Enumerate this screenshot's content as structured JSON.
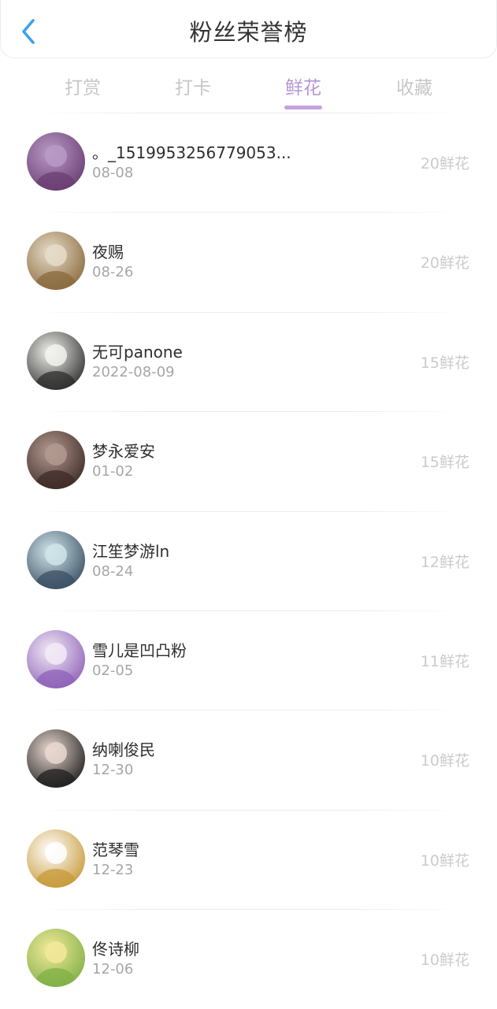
{
  "header": {
    "title": "粉丝荣誉榜",
    "back_icon": "chevron-left-icon",
    "accent_color": "#3aa3e8"
  },
  "tabs": [
    {
      "label": "打赏"
    },
    {
      "label": "打卡"
    },
    {
      "label": "鲜花",
      "active": true
    },
    {
      "label": "收藏"
    }
  ],
  "active_tab_color": "#b794d6",
  "fans": [
    {
      "name": "。_1519953256779053...",
      "date": "08-08",
      "amount": "20鲜花",
      "avatar_colors": [
        "#6a3d72",
        "#b99ac6"
      ]
    },
    {
      "name": "夜赐",
      "date": "08-26",
      "amount": "20鲜花",
      "avatar_colors": [
        "#8a6a3d",
        "#e6dcc8"
      ]
    },
    {
      "name": "无可panone",
      "date": "2022-08-09",
      "amount": "15鲜花",
      "avatar_colors": [
        "#2e2e2e",
        "#f2f2ee"
      ]
    },
    {
      "name": "梦永爱安",
      "date": "01-02",
      "amount": "15鲜花",
      "avatar_colors": [
        "#3d2a26",
        "#b39a90"
      ]
    },
    {
      "name": "江笙梦游ln",
      "date": "08-24",
      "amount": "12鲜花",
      "avatar_colors": [
        "#3b4f63",
        "#cfe5ea"
      ]
    },
    {
      "name": "雪儿是凹凸粉",
      "date": "02-05",
      "amount": "11鲜花",
      "avatar_colors": [
        "#8e62b8",
        "#f2eaf6"
      ]
    },
    {
      "name": "纳喇俊民",
      "date": "12-30",
      "amount": "10鲜花",
      "avatar_colors": [
        "#1f1f1f",
        "#e9d8cf"
      ]
    },
    {
      "name": "范琴雪",
      "date": "12-23",
      "amount": "10鲜花",
      "avatar_colors": [
        "#c79a3a",
        "#ffffff"
      ]
    },
    {
      "name": "佟诗柳",
      "date": "12-06",
      "amount": "10鲜花",
      "avatar_colors": [
        "#7fb046",
        "#f2e99a"
      ]
    }
  ]
}
